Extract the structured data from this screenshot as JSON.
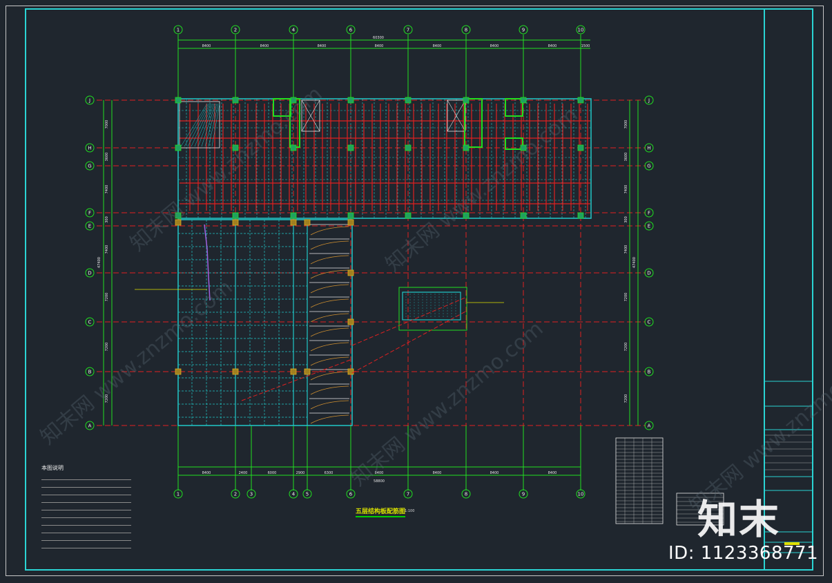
{
  "drawing": {
    "title": "五层结构板配筋图",
    "scale": "1:100",
    "notes_title": "本图说明",
    "note_lines": 10
  },
  "grid": {
    "x_labels": [
      "1",
      "2",
      "4",
      "6",
      "7",
      "8",
      "9",
      "10"
    ],
    "x_labels_bottom": [
      "1",
      "2",
      "3",
      "4",
      "5",
      "6",
      "7",
      "8",
      "9",
      "10"
    ],
    "y_labels": [
      "J",
      "H",
      "G",
      "F",
      "E",
      "D",
      "C",
      "B",
      "A"
    ],
    "top_dims": [
      "8400",
      "8400",
      "8400",
      "8400",
      "8400",
      "8400",
      "8400",
      "1500"
    ],
    "top_total": "60300",
    "bottom_dims": [
      "8400",
      "2400",
      "6000",
      "2900",
      "6300",
      "8400",
      "8400",
      "8400",
      "8400"
    ],
    "bottom_total": "58800",
    "left_dims": [
      "7000",
      "3600",
      "7400",
      "300",
      "7400",
      "7200",
      "7200",
      "7200"
    ],
    "left_total": "47400",
    "right_total": "47400"
  },
  "branding": {
    "logo": "知末",
    "id_text": "ID: 1123368771",
    "watermark": "知末网 www.znzmo.com"
  },
  "colors": {
    "background": "#1f262e",
    "frame": "#2ad4d4",
    "grid_line": "#e02020",
    "dim_line": "#20e020",
    "beam": "#20c8c8",
    "rebar": "#e02020"
  }
}
